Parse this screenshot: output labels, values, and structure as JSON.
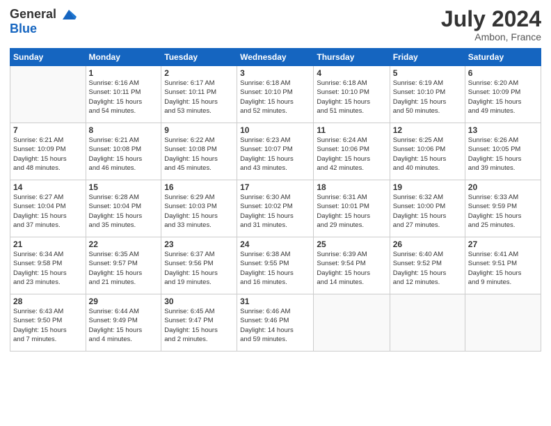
{
  "header": {
    "logo_line1": "General",
    "logo_line2": "Blue",
    "month_year": "July 2024",
    "location": "Ambon, France"
  },
  "days_of_week": [
    "Sunday",
    "Monday",
    "Tuesday",
    "Wednesday",
    "Thursday",
    "Friday",
    "Saturday"
  ],
  "weeks": [
    [
      {
        "day": "",
        "info": ""
      },
      {
        "day": "1",
        "info": "Sunrise: 6:16 AM\nSunset: 10:11 PM\nDaylight: 15 hours\nand 54 minutes."
      },
      {
        "day": "2",
        "info": "Sunrise: 6:17 AM\nSunset: 10:11 PM\nDaylight: 15 hours\nand 53 minutes."
      },
      {
        "day": "3",
        "info": "Sunrise: 6:18 AM\nSunset: 10:10 PM\nDaylight: 15 hours\nand 52 minutes."
      },
      {
        "day": "4",
        "info": "Sunrise: 6:18 AM\nSunset: 10:10 PM\nDaylight: 15 hours\nand 51 minutes."
      },
      {
        "day": "5",
        "info": "Sunrise: 6:19 AM\nSunset: 10:10 PM\nDaylight: 15 hours\nand 50 minutes."
      },
      {
        "day": "6",
        "info": "Sunrise: 6:20 AM\nSunset: 10:09 PM\nDaylight: 15 hours\nand 49 minutes."
      }
    ],
    [
      {
        "day": "7",
        "info": "Sunrise: 6:21 AM\nSunset: 10:09 PM\nDaylight: 15 hours\nand 48 minutes."
      },
      {
        "day": "8",
        "info": "Sunrise: 6:21 AM\nSunset: 10:08 PM\nDaylight: 15 hours\nand 46 minutes."
      },
      {
        "day": "9",
        "info": "Sunrise: 6:22 AM\nSunset: 10:08 PM\nDaylight: 15 hours\nand 45 minutes."
      },
      {
        "day": "10",
        "info": "Sunrise: 6:23 AM\nSunset: 10:07 PM\nDaylight: 15 hours\nand 43 minutes."
      },
      {
        "day": "11",
        "info": "Sunrise: 6:24 AM\nSunset: 10:06 PM\nDaylight: 15 hours\nand 42 minutes."
      },
      {
        "day": "12",
        "info": "Sunrise: 6:25 AM\nSunset: 10:06 PM\nDaylight: 15 hours\nand 40 minutes."
      },
      {
        "day": "13",
        "info": "Sunrise: 6:26 AM\nSunset: 10:05 PM\nDaylight: 15 hours\nand 39 minutes."
      }
    ],
    [
      {
        "day": "14",
        "info": "Sunrise: 6:27 AM\nSunset: 10:04 PM\nDaylight: 15 hours\nand 37 minutes."
      },
      {
        "day": "15",
        "info": "Sunrise: 6:28 AM\nSunset: 10:04 PM\nDaylight: 15 hours\nand 35 minutes."
      },
      {
        "day": "16",
        "info": "Sunrise: 6:29 AM\nSunset: 10:03 PM\nDaylight: 15 hours\nand 33 minutes."
      },
      {
        "day": "17",
        "info": "Sunrise: 6:30 AM\nSunset: 10:02 PM\nDaylight: 15 hours\nand 31 minutes."
      },
      {
        "day": "18",
        "info": "Sunrise: 6:31 AM\nSunset: 10:01 PM\nDaylight: 15 hours\nand 29 minutes."
      },
      {
        "day": "19",
        "info": "Sunrise: 6:32 AM\nSunset: 10:00 PM\nDaylight: 15 hours\nand 27 minutes."
      },
      {
        "day": "20",
        "info": "Sunrise: 6:33 AM\nSunset: 9:59 PM\nDaylight: 15 hours\nand 25 minutes."
      }
    ],
    [
      {
        "day": "21",
        "info": "Sunrise: 6:34 AM\nSunset: 9:58 PM\nDaylight: 15 hours\nand 23 minutes."
      },
      {
        "day": "22",
        "info": "Sunrise: 6:35 AM\nSunset: 9:57 PM\nDaylight: 15 hours\nand 21 minutes."
      },
      {
        "day": "23",
        "info": "Sunrise: 6:37 AM\nSunset: 9:56 PM\nDaylight: 15 hours\nand 19 minutes."
      },
      {
        "day": "24",
        "info": "Sunrise: 6:38 AM\nSunset: 9:55 PM\nDaylight: 15 hours\nand 16 minutes."
      },
      {
        "day": "25",
        "info": "Sunrise: 6:39 AM\nSunset: 9:54 PM\nDaylight: 15 hours\nand 14 minutes."
      },
      {
        "day": "26",
        "info": "Sunrise: 6:40 AM\nSunset: 9:52 PM\nDaylight: 15 hours\nand 12 minutes."
      },
      {
        "day": "27",
        "info": "Sunrise: 6:41 AM\nSunset: 9:51 PM\nDaylight: 15 hours\nand 9 minutes."
      }
    ],
    [
      {
        "day": "28",
        "info": "Sunrise: 6:43 AM\nSunset: 9:50 PM\nDaylight: 15 hours\nand 7 minutes."
      },
      {
        "day": "29",
        "info": "Sunrise: 6:44 AM\nSunset: 9:49 PM\nDaylight: 15 hours\nand 4 minutes."
      },
      {
        "day": "30",
        "info": "Sunrise: 6:45 AM\nSunset: 9:47 PM\nDaylight: 15 hours\nand 2 minutes."
      },
      {
        "day": "31",
        "info": "Sunrise: 6:46 AM\nSunset: 9:46 PM\nDaylight: 14 hours\nand 59 minutes."
      },
      {
        "day": "",
        "info": ""
      },
      {
        "day": "",
        "info": ""
      },
      {
        "day": "",
        "info": ""
      }
    ]
  ]
}
